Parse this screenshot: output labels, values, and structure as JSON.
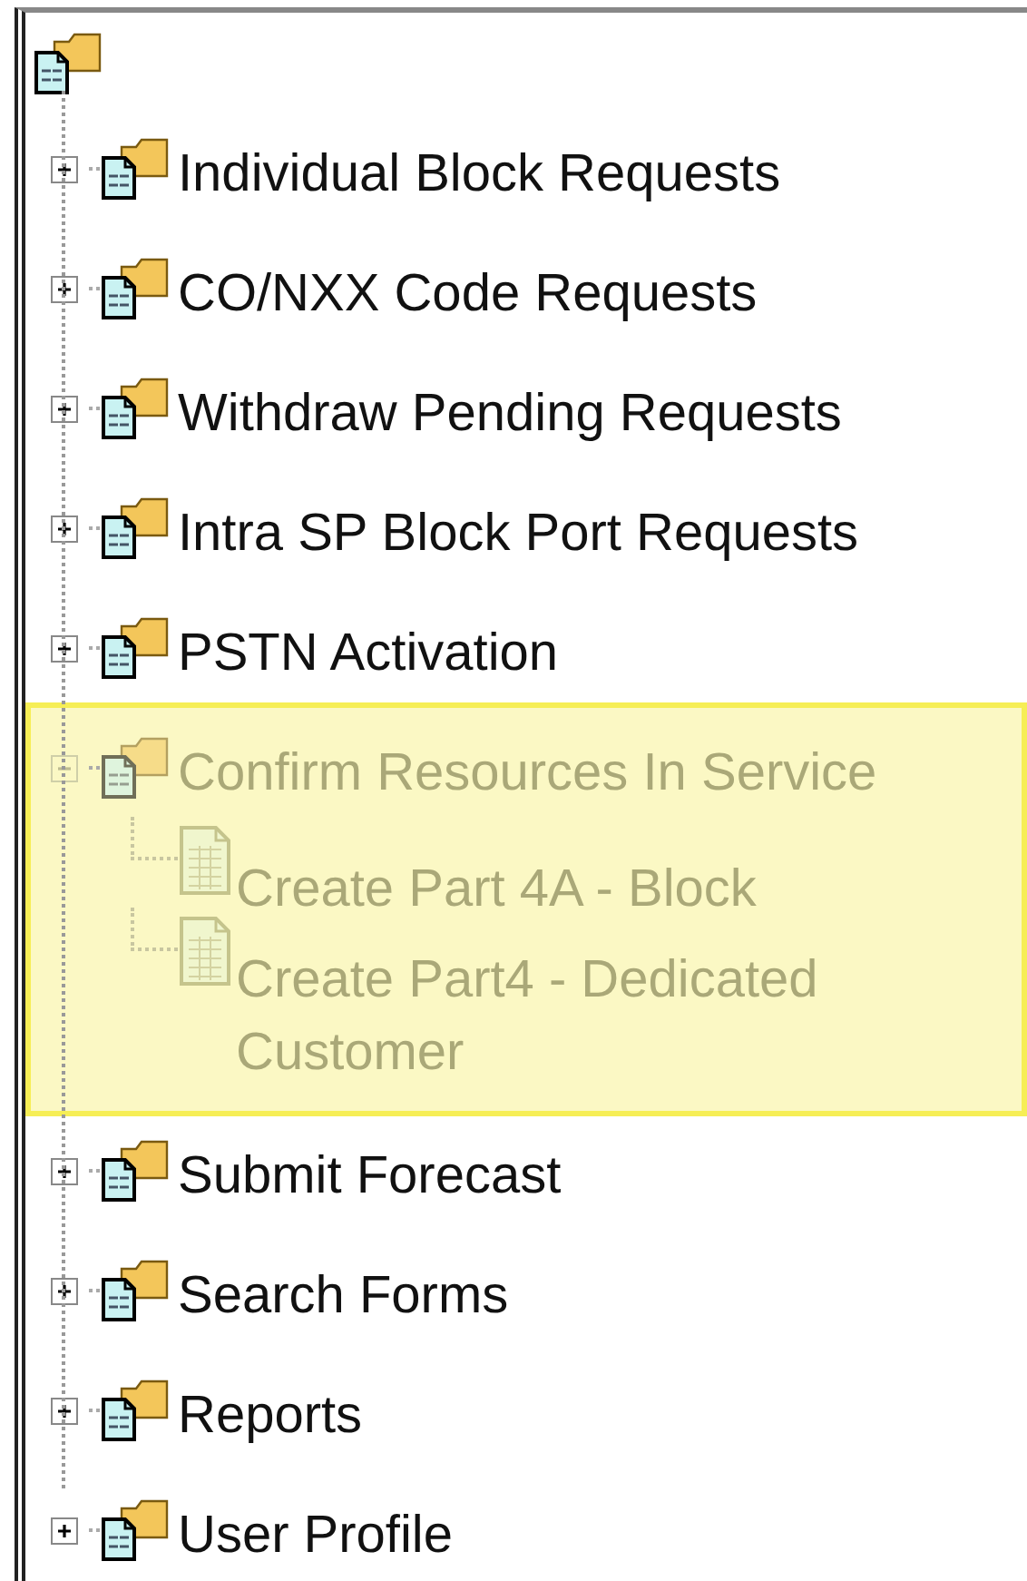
{
  "tree": {
    "items": [
      {
        "label": "Individual Block Requests",
        "expanded": false,
        "selected": false
      },
      {
        "label": "CO/NXX Code Requests",
        "expanded": false,
        "selected": false
      },
      {
        "label": "Withdraw Pending Requests",
        "expanded": false,
        "selected": false
      },
      {
        "label": "Intra SP Block Port Requests",
        "expanded": false,
        "selected": false
      },
      {
        "label": "PSTN Activation",
        "expanded": false,
        "selected": false
      },
      {
        "label": "Confirm Resources In Service",
        "expanded": true,
        "selected": true,
        "children": [
          {
            "label": "Create Part 4A - Block"
          },
          {
            "label": "Create Part4 - Dedicated Customer"
          }
        ]
      },
      {
        "label": "Submit Forecast",
        "expanded": false,
        "selected": false
      },
      {
        "label": "Search Forms",
        "expanded": false,
        "selected": false
      },
      {
        "label": "Reports",
        "expanded": false,
        "selected": false
      },
      {
        "label": "User Profile",
        "expanded": false,
        "selected": false
      }
    ]
  }
}
